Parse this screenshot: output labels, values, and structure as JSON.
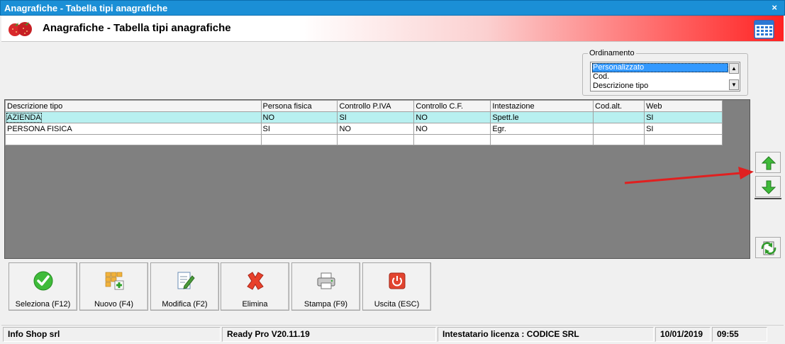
{
  "window": {
    "title": "Anagrafiche - Tabella tipi anagrafiche",
    "close_label": "×"
  },
  "header": {
    "title": "Anagrafiche - Tabella tipi anagrafiche",
    "logo_icon": "strawberry-icon",
    "calendar_icon": "calendar-icon"
  },
  "ordinamento": {
    "legend": "Ordinamento",
    "options": [
      "Personalizzato",
      "Cod.",
      "Descrizione tipo"
    ],
    "selected": "Personalizzato"
  },
  "grid": {
    "columns": [
      "Descrizione tipo",
      "Persona fisica",
      "Controllo P.IVA",
      "Controllo C.F.",
      "Intestazione",
      "Cod.alt.",
      "Web"
    ],
    "rows": [
      [
        "AZIENDA",
        "NO",
        "SI",
        "NO",
        "Spett.le",
        "",
        "SI"
      ],
      [
        "PERSONA FISICA",
        "SI",
        "NO",
        "NO",
        "Egr.",
        "",
        "SI"
      ],
      [
        "",
        "",
        "",
        "",
        "",
        "",
        ""
      ]
    ],
    "selected_row": 0
  },
  "side_buttons": {
    "up_icon": "arrow-up-icon",
    "down_icon": "arrow-down-icon",
    "refresh_icon": "refresh-icon"
  },
  "toolbar": {
    "seleziona": "Seleziona (F12)",
    "nuovo": "Nuovo (F4)",
    "modifica": "Modifica (F2)",
    "elimina": "Elimina",
    "stampa": "Stampa (F9)",
    "uscita": "Uscita (ESC)"
  },
  "status": {
    "company": "Info Shop srl",
    "version": "Ready Pro V20.11.19",
    "license": "Intestatario licenza : CODICE SRL",
    "date": "10/01/2019",
    "time": "09:55"
  },
  "colors": {
    "accent": "#1b8fd6",
    "selected_row": "#b8f0f0",
    "arrow": "#e02020"
  }
}
